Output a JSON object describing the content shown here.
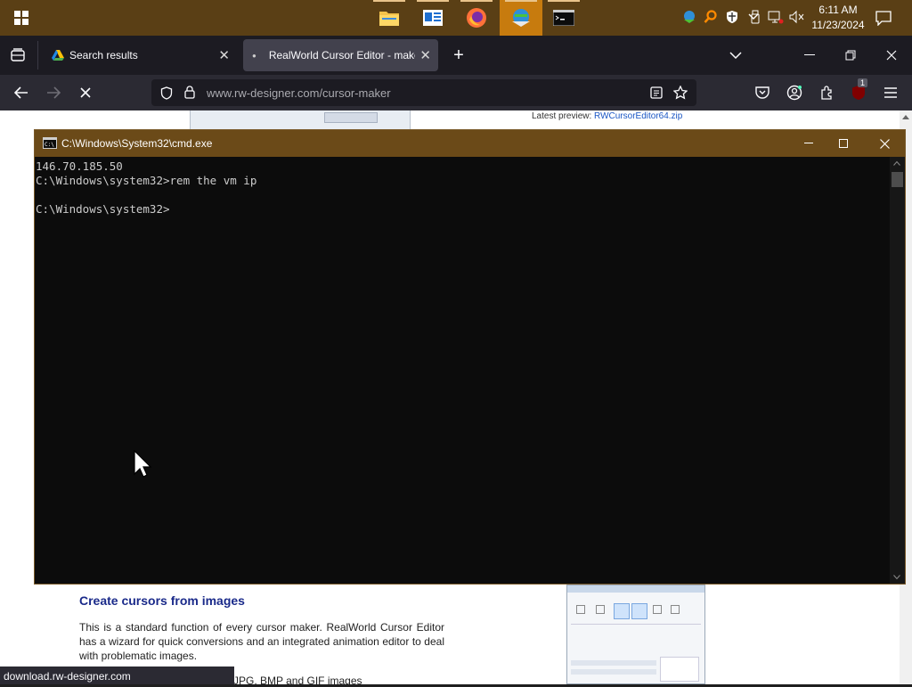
{
  "taskbar": {
    "pinned": [
      {
        "name": "file-explorer",
        "active": false
      },
      {
        "name": "news-app",
        "active": false
      },
      {
        "name": "firefox",
        "active": false
      },
      {
        "name": "network-manager",
        "active": true
      },
      {
        "name": "command-prompt",
        "active": false
      }
    ],
    "clock": {
      "time": "6:11 AM",
      "date": "11/23/2024"
    }
  },
  "browser": {
    "tabs": [
      {
        "label": "Search results",
        "active": false
      },
      {
        "label": "RealWorld Cursor Editor - make",
        "active": true
      }
    ],
    "new_tab": "+",
    "address": {
      "domain": "www.rw-designer.com",
      "path": "/cursor-maker"
    },
    "extension_badge": "1"
  },
  "webpage": {
    "latest_preview_label": "Latest preview:",
    "latest_preview_link": "RWCursorEditor64.zip",
    "section_heading": "Create cursors from images",
    "section_paragraph": "This is a standard function of every cursor maker. RealWorld Cursor Editor has a wizard for quick conversions and an integrated animation editor to deal with problematic images.",
    "partial_text": "JPG, BMP and GIF images",
    "status_url": "download.rw-designer.com"
  },
  "cmd": {
    "title": "C:\\Windows\\System32\\cmd.exe",
    "lines": [
      "146.70.185.50",
      "C:\\Windows\\system32>rem the vm ip",
      "",
      "C:\\Windows\\system32>"
    ]
  },
  "colors": {
    "taskbar": "#5a3f15",
    "taskbar_active": "#c77b0e",
    "cmd_title": "#6b4a18",
    "link": "#1a56c4",
    "heading": "#1a2a8a"
  }
}
